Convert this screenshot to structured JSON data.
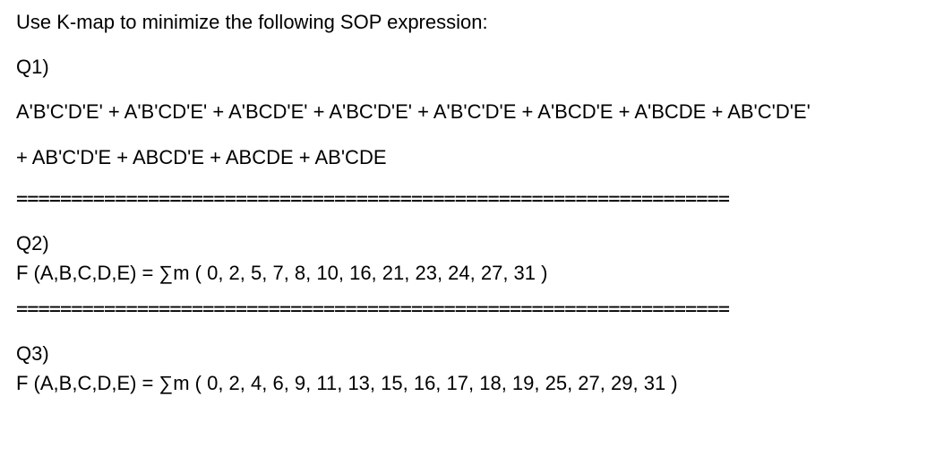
{
  "title": "Use K-map to minimize the following SOP expression:",
  "q1": {
    "label": "Q1)",
    "expr_line1": "A'B'C'D'E' + A'B'CD'E' + A'BCD'E' + A'BC'D'E' + A'B'C'D'E + A'BCD'E + A'BCDE + AB'C'D'E'",
    "expr_line2": " + AB'C'D'E + ABCD'E + ABCDE + AB'CDE"
  },
  "separator": "=================================================================",
  "q2": {
    "label": "Q2)",
    "func": "F (A,B,C,D,E)  =  ∑m  ( 0, 2, 5, 7, 8, 10, 16, 21, 23, 24, 27, 31 )"
  },
  "q3": {
    "label": "Q3)",
    "func": "F (A,B,C,D,E)  =  ∑m  ( 0, 2, 4, 6, 9, 11, 13, 15, 16, 17, 18, 19, 25, 27, 29, 31 )"
  }
}
